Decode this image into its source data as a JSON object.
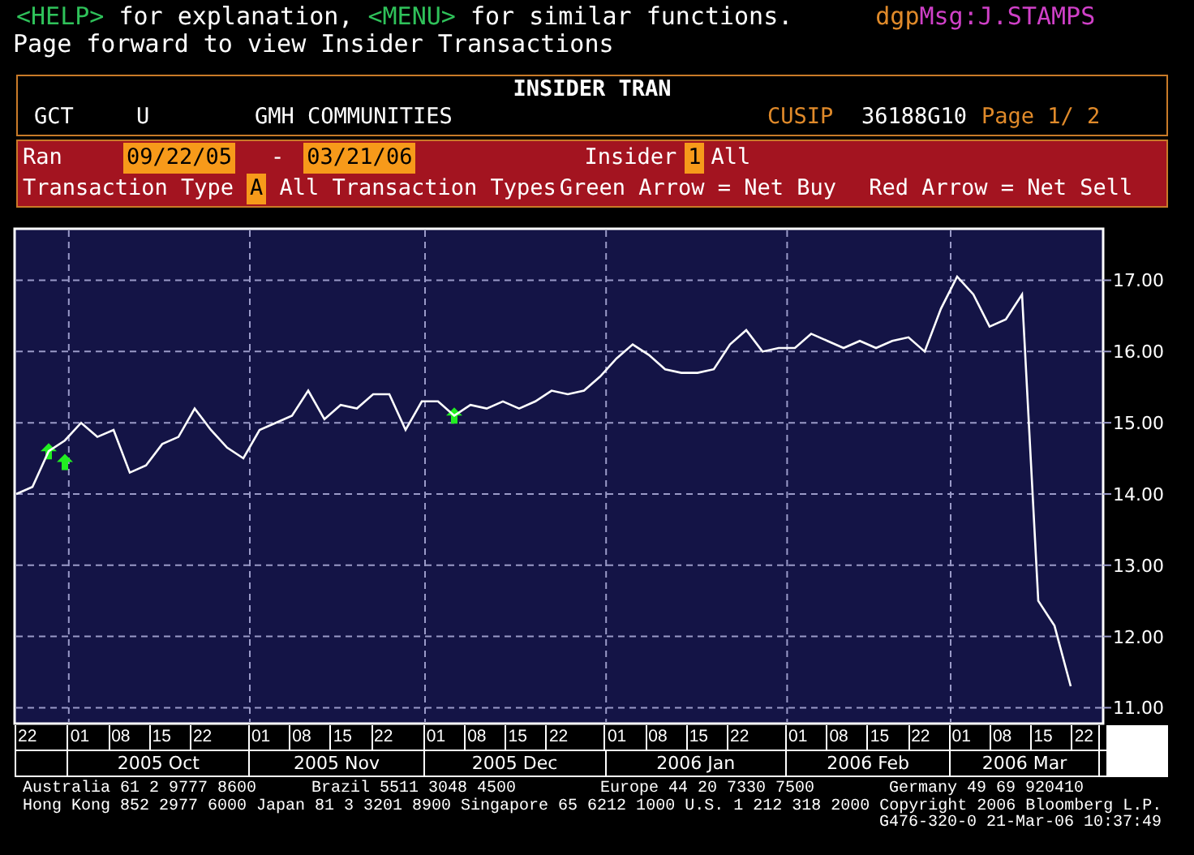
{
  "help_line": [
    {
      "text": "<HELP>",
      "kind": "key"
    },
    {
      "text": " for explanation, ",
      "kind": "plain"
    },
    {
      "text": "<MENU>",
      "kind": "key"
    },
    {
      "text": " for similar functions.",
      "kind": "plain"
    }
  ],
  "message": {
    "prefix": "dgp",
    "text": "Msg:J.STAMPS"
  },
  "hint": "Page forward to view Insider Transactions",
  "header": {
    "title": "INSIDER TRAN",
    "ticker": "GCT",
    "exchange": "U",
    "company": "GMH COMMUNITIES",
    "cusip_label": "CUSIP",
    "cusip": "36188G10",
    "page": "Page 1/ 2"
  },
  "filters": {
    "range_label": "Ran",
    "start": "09/22/05",
    "dash": "-",
    "end": "03/21/06",
    "insider_label": "Insider",
    "insider_code": "1",
    "insider_value": "All",
    "type_label": "Transaction Type",
    "type_code": "A",
    "type_value": "All Transaction Types",
    "legend": [
      "Green Arrow = Net Buy",
      "Red Arrow = Net Sell"
    ]
  },
  "chart": {
    "chart_data": {
      "type": "line",
      "ylim": [
        10.8,
        17.7
      ],
      "yticks": [
        {
          "value": 11,
          "label": "11.00"
        },
        {
          "value": 12,
          "label": "12.00"
        },
        {
          "value": 13,
          "label": "13.00"
        },
        {
          "value": 14,
          "label": "14.00"
        },
        {
          "value": 15,
          "label": "15.00"
        },
        {
          "value": 16,
          "label": "16.00"
        },
        {
          "value": 17,
          "label": "17.00"
        }
      ],
      "grid": true,
      "series": [
        {
          "color": "#ffffff",
          "values": [
            14.0,
            14.1,
            14.6,
            14.75,
            15.0,
            14.8,
            14.9,
            14.3,
            14.4,
            14.7,
            14.8,
            15.2,
            14.9,
            14.65,
            14.5,
            14.9,
            15.0,
            15.1,
            15.45,
            15.05,
            15.25,
            15.2,
            15.4,
            15.4,
            14.9,
            15.3,
            15.3,
            15.1,
            15.25,
            15.2,
            15.3,
            15.2,
            15.3,
            15.45,
            15.4,
            15.45,
            15.65,
            15.9,
            16.1,
            15.95,
            15.75,
            15.7,
            15.7,
            15.75,
            16.1,
            16.3,
            16.0,
            16.05,
            16.05,
            16.25,
            16.15,
            16.05,
            16.15,
            16.05,
            16.15,
            16.2,
            16.0,
            16.6,
            17.05,
            16.8,
            16.35,
            16.45,
            16.8,
            12.5,
            12.15,
            11.3
          ]
        },
        {
          "type": "scatter",
          "color": "#22ee22",
          "values": [
            null,
            null,
            14.6,
            14.45,
            null,
            null,
            null,
            null,
            null,
            null,
            null,
            null,
            null,
            null,
            null,
            null,
            null,
            null,
            null,
            null,
            null,
            null,
            null,
            null,
            null,
            null,
            null,
            15.1,
            null,
            null,
            null,
            null,
            null,
            null,
            null,
            null,
            null,
            null,
            null,
            null,
            null,
            null,
            null,
            null,
            null,
            null,
            null,
            null,
            null,
            null,
            null,
            null,
            null,
            null,
            null,
            null,
            null,
            null,
            null,
            null,
            null,
            null,
            null,
            null,
            null,
            null
          ]
        }
      ]
    },
    "day_ticks": [
      "22",
      "01",
      "08",
      "15",
      "22",
      "01",
      "08",
      "15",
      "22",
      "01",
      "08",
      "15",
      "22",
      "01",
      "08",
      "15",
      "22",
      "01",
      "08",
      "15",
      "22",
      "01",
      "08",
      "15",
      "22"
    ],
    "months": [
      "2005 Oct",
      "2005 Nov",
      "2005 Dec",
      "2006 Jan",
      "2006 Feb",
      "2006 Mar"
    ]
  },
  "footer": {
    "offices": [
      "Australia 61 2 9777 8600",
      "Brazil 5511 3048 4500",
      "Europe 44 20 7330 7500",
      "Germany 49 69 920410"
    ],
    "offices_line": "Hong Kong 852 2977 6000 Japan 81 3 3201 8900 Singapore 65 6212 1000 U.S. 1 212 318 2000 Copyright 2006 Bloomberg L.P.",
    "stamp": "G476-320-0 21-Mar-06 10:37:49"
  }
}
